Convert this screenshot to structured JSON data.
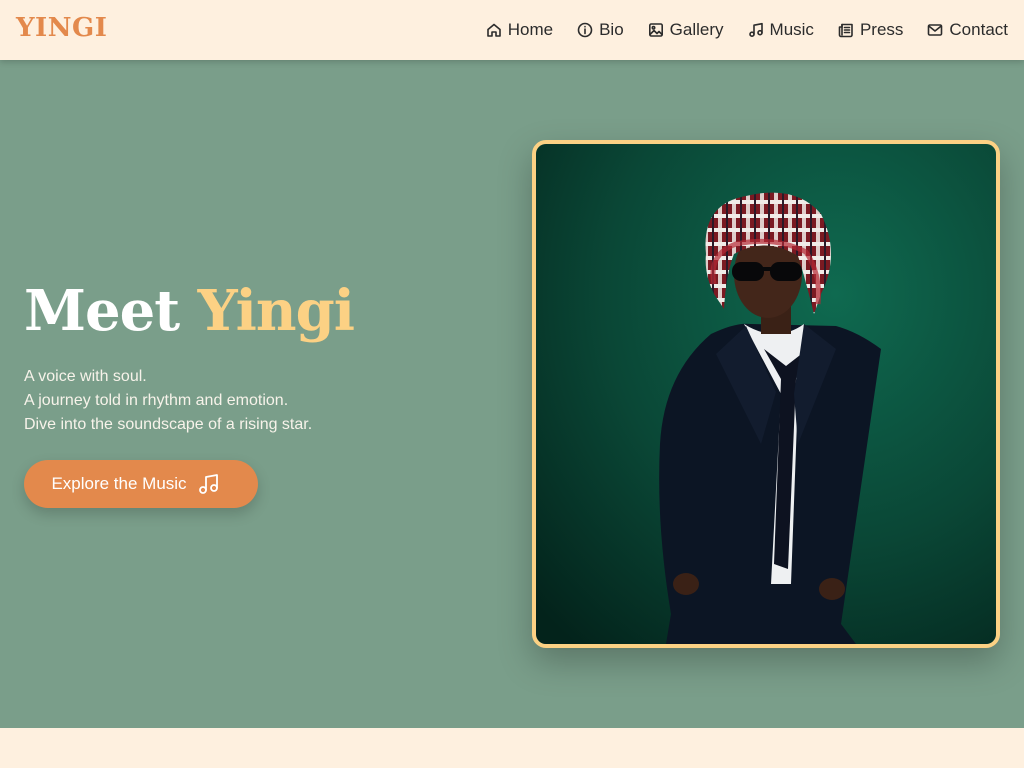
{
  "brand": {
    "logo": "YINGI",
    "accent_color": "#e3894c"
  },
  "nav": {
    "items": [
      {
        "label": "Home",
        "icon": "home-icon"
      },
      {
        "label": "Bio",
        "icon": "info-icon"
      },
      {
        "label": "Gallery",
        "icon": "image-icon"
      },
      {
        "label": "Music",
        "icon": "music-note-icon"
      },
      {
        "label": "Press",
        "icon": "newspaper-icon"
      },
      {
        "label": "Contact",
        "icon": "mail-icon"
      }
    ]
  },
  "hero": {
    "headline_main": "Meet",
    "headline_accent": "Yingi",
    "tagline": [
      "A voice with soul.",
      "A journey told in rhythm and emotion.",
      "Dive into the soundscape of a rising star."
    ],
    "cta_label": "Explore the Music",
    "cta_icon": "music-note-icon",
    "background_color": "#7a9e8a",
    "highlight_color": "#fcd184"
  },
  "photo": {
    "alt": "Portrait of Yingi"
  }
}
